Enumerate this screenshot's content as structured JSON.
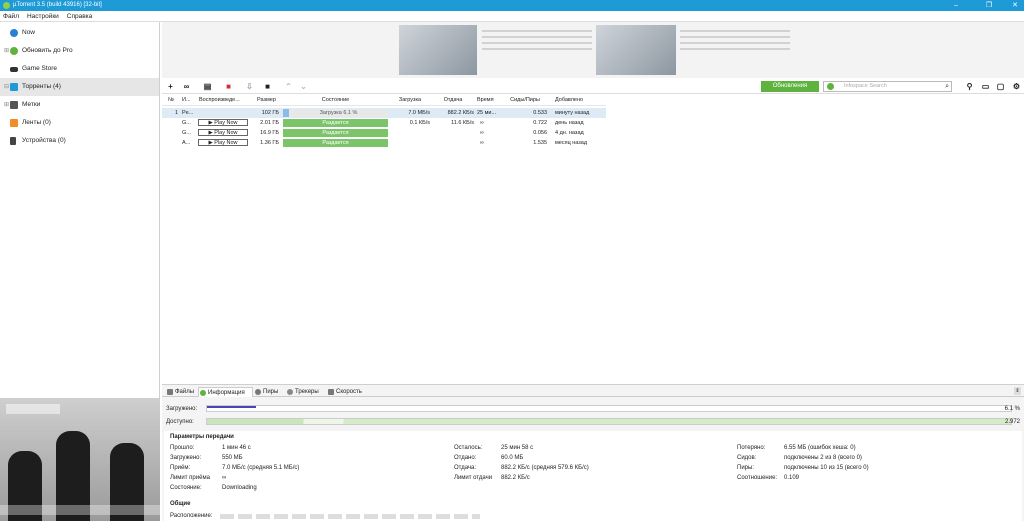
{
  "window": {
    "title": "µTorrent 3.5  (build 43916) [32-bit]"
  },
  "menu": [
    "Файл",
    "Настройки",
    "Справка"
  ],
  "sidebar": [
    {
      "label": "Now",
      "icon": "now-icon"
    },
    {
      "label": "Обновить до Pro",
      "icon": "pro-upgrade-icon"
    },
    {
      "label": "Game Store",
      "icon": "game-store-icon"
    },
    {
      "label": "Торренты (4)",
      "icon": "torrents-icon"
    },
    {
      "label": "Метки",
      "icon": "labels-icon"
    },
    {
      "label": "Ленты (0)",
      "icon": "feeds-icon"
    },
    {
      "label": "Устройства (0)",
      "icon": "devices-icon"
    }
  ],
  "toolbar": {
    "update_label": "Обновления",
    "search_placeholder": "Infospace Search"
  },
  "columns": [
    "№",
    "И...",
    "Воспроизведе...",
    "Размер",
    "Состояние",
    "Загрузка",
    "Отдача",
    "Время",
    "Сиды/Пиры",
    "Добавлено"
  ],
  "torrents": [
    {
      "num": "1",
      "name": "Pe...",
      "play": "",
      "size": "102 ГБ",
      "status": "Загрузка 6.1 %",
      "down": "7.0 МБ/s",
      "up": "882.2 КБ/s",
      "eta": "25 ми...",
      "ratio": "0.533",
      "added": "минуту назад"
    },
    {
      "num": "",
      "name": "G...",
      "play": "▶ Play Now",
      "size": "2.01 ГБ",
      "status": "Раздается",
      "down": "0.1 КБ/s",
      "up": "11.6 КБ/s",
      "eta": "∞",
      "ratio": "0.722",
      "added": "день назад"
    },
    {
      "num": "",
      "name": "G...",
      "play": "▶ Play Now",
      "size": "16.9 ГБ",
      "status": "Раздается",
      "down": "",
      "up": "",
      "eta": "∞",
      "ratio": "0.056",
      "added": "4 дн. назад"
    },
    {
      "num": "",
      "name": "A...",
      "play": "▶ Play Now",
      "size": "1.36 ГБ",
      "status": "Раздается",
      "down": "",
      "up": "",
      "eta": "∞",
      "ratio": "1.535",
      "added": "месяц назад"
    }
  ],
  "tabs": [
    "Файлы",
    "Информация",
    "Пиры",
    "Трекеры",
    "Скорость"
  ],
  "bars": {
    "downloaded_label": "Загружено:",
    "downloaded_value": "6.1 %",
    "downloaded_fraction": 0.061,
    "available_label": "Доступно:",
    "available_value": "2.972"
  },
  "transfer": {
    "section": "Параметры передачи",
    "col1": [
      {
        "k": "Прошло:",
        "v": "1 мин 46 с"
      },
      {
        "k": "Загружено:",
        "v": "550 МБ"
      },
      {
        "k": "Приём:",
        "v": "7.0 МБ/с (средняя 5.1 МБ/с)"
      },
      {
        "k": "Лимит приёма",
        "v": "∞"
      },
      {
        "k": "Состояние:",
        "v": "Downloading"
      }
    ],
    "col2": [
      {
        "k": "Осталось:",
        "v": "25 мин 58 с"
      },
      {
        "k": "Отдано:",
        "v": "60.0 МБ"
      },
      {
        "k": "Отдача:",
        "v": "882.2 КБ/с (средняя 579.6 КБ/с)"
      },
      {
        "k": "Лимит отдачи",
        "v": "882.2 КБ/с"
      }
    ],
    "col3": [
      {
        "k": "Потеряно:",
        "v": "6.55 МБ (ошибок хеша: 0)"
      },
      {
        "k": "Сидов:",
        "v": "подключены 2 из 8 (всего 0)"
      },
      {
        "k": "Пиры:",
        "v": "подключены 10 из 15 (всего 0)"
      },
      {
        "k": "Соотношение:",
        "v": "0.109"
      }
    ]
  },
  "general": {
    "section": "Общие",
    "location_label": "Расположение:"
  }
}
